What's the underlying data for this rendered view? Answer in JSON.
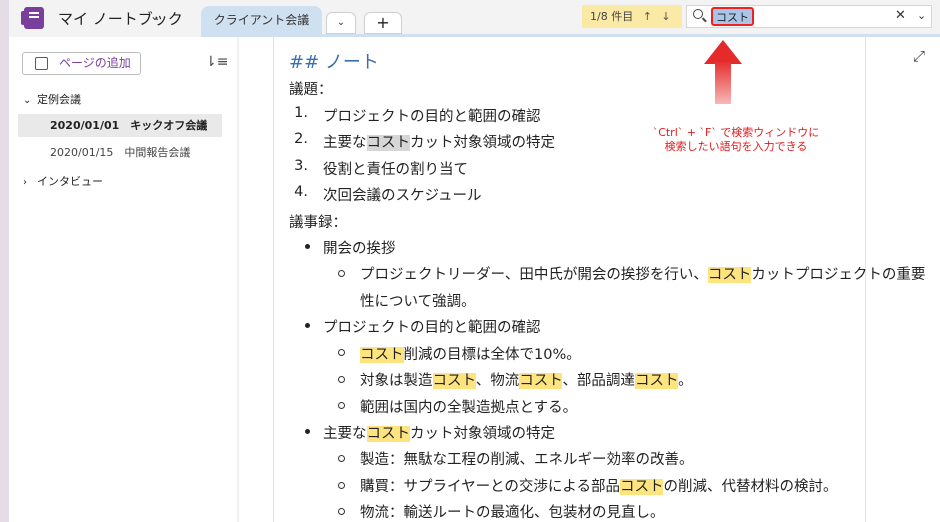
{
  "header": {
    "notebook_title": "マイ ノートブック",
    "active_tab": "クライアント会議",
    "add_tab": "+"
  },
  "search": {
    "result_count": "1/8 件目",
    "query": "コスト"
  },
  "sidebar": {
    "add_page_label": "ページの追加",
    "sections": [
      {
        "label": "定例会議",
        "expanded": true
      },
      {
        "label": "インタビュー",
        "expanded": false
      }
    ],
    "pages": [
      {
        "label": "2020/01/01　キックオフ会議",
        "active": true
      },
      {
        "label": "2020/01/15　中間報告会議",
        "active": false
      }
    ]
  },
  "note": {
    "heading": "## ノート",
    "agenda_label": "議題：",
    "agenda": [
      {
        "num": "1.",
        "text": "プロジェクトの目的と範囲の確認"
      },
      {
        "num": "2.",
        "pre": "主要な",
        "hit": "コスト",
        "post": "カット対象領域の特定"
      },
      {
        "num": "3.",
        "text": "役割と責任の割り当て"
      },
      {
        "num": "4.",
        "text": "次回会議のスケジュール"
      }
    ],
    "minutes_label": "議事録：",
    "minutes": [
      {
        "label": "開会の挨拶",
        "sub": [
          {
            "p1": "プロジェクトリーダー、田中氏が開会の挨拶を行い、",
            "h1": "コスト",
            "p2": "カットプロジェクトの重要",
            "cont": "性について強調。"
          }
        ]
      },
      {
        "label": "プロジェクトの目的と範囲の確認",
        "sub": [
          {
            "h1": "コスト",
            "p2": "削減の目標は全体で10%。"
          },
          {
            "p1": "対象は製造",
            "h1": "コスト",
            "p2": "、物流",
            "h2": "コスト",
            "p3": "、部品調達",
            "h3": "コスト",
            "p4": "。"
          },
          {
            "p1": "範囲は国内の全製造拠点とする。"
          }
        ]
      },
      {
        "label_pre": "主要な",
        "label_hit": "コスト",
        "label_post": "カット対象領域の特定",
        "sub": [
          {
            "p1": "製造：無駄な工程の削減、エネルギー効率の改善。"
          },
          {
            "p1": "購買：サプライヤーとの交渉による部品",
            "h1": "コスト",
            "p2": "の削減、代替材料の検討。"
          },
          {
            "p1": "物流：輸送ルートの最適化、包装材の見直し。"
          }
        ]
      }
    ]
  },
  "annotation": {
    "line1": "`Ctrl` + `F` で検索ウィンドウに",
    "line2": "検索したい語句を入力できる"
  },
  "colors": {
    "brand": "#7a3e9d",
    "heading": "#3a6fb0",
    "highlight": "#fde47f",
    "annotation": "#e01a1a"
  }
}
